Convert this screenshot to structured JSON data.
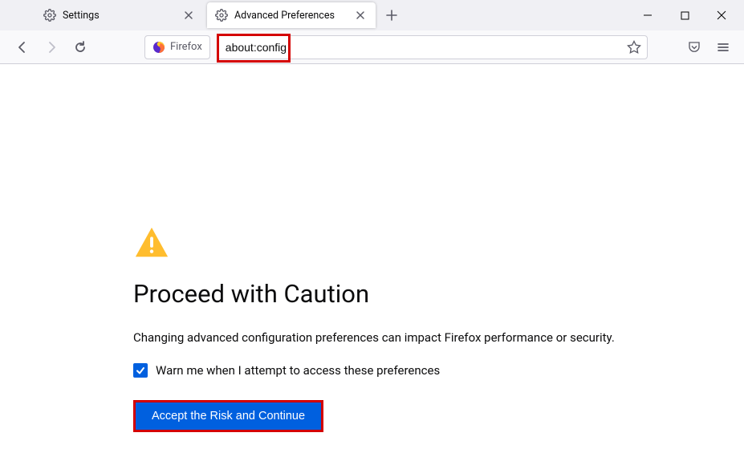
{
  "tabs": [
    {
      "title": "Settings"
    },
    {
      "title": "Advanced Preferences"
    }
  ],
  "identity_label": "Firefox",
  "url": "about:config",
  "warning": {
    "title": "Proceed with Caution",
    "description": "Changing advanced configuration preferences can impact Firefox performance or security.",
    "checkbox_label": "Warn me when I attempt to access these preferences",
    "button_label": "Accept the Risk and Continue"
  }
}
